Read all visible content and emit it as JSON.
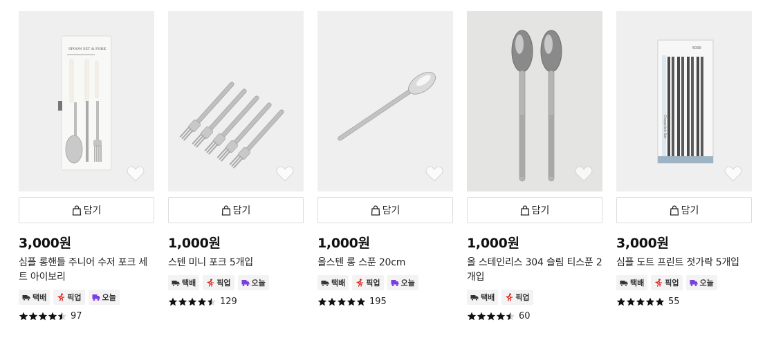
{
  "cart_label": "담기",
  "tags": {
    "delivery": "택배",
    "pickup": "픽업",
    "today": "오늘"
  },
  "products": [
    {
      "price": "3,000원",
      "name": "심플 롱핸들 주니어 수저 포크 세트 아이보리",
      "tags": [
        "delivery",
        "pickup",
        "today"
      ],
      "rating_stars": 4.5,
      "reviews": "97",
      "image_icon": "spoon-fork-set-package-icon"
    },
    {
      "price": "1,000원",
      "name": "스텐 미니 포크 5개입",
      "tags": [
        "delivery",
        "pickup",
        "today"
      ],
      "rating_stars": 4.5,
      "reviews": "129",
      "image_icon": "mini-forks-icon"
    },
    {
      "price": "1,000원",
      "name": "올스텐 롱 스푼 20cm",
      "tags": [
        "delivery",
        "pickup",
        "today"
      ],
      "rating_stars": 5,
      "reviews": "195",
      "image_icon": "long-spoon-icon"
    },
    {
      "price": "1,000원",
      "name": "올 스테인리스 304 슬림 티스푼 2개입",
      "tags": [
        "delivery",
        "pickup"
      ],
      "rating_stars": 4.5,
      "reviews": "60",
      "image_icon": "teaspoons-icon"
    },
    {
      "price": "3,000원",
      "name": "심플 도트 프린트 젓가락 5개입",
      "tags": [
        "delivery",
        "pickup",
        "today"
      ],
      "rating_stars": 5,
      "reviews": "55",
      "image_icon": "chopsticks-package-icon"
    }
  ],
  "package_text": {
    "p1_title": "SPOON SET & FORK",
    "p5_brand": "5000",
    "p5_side": "Chopstick Set"
  }
}
